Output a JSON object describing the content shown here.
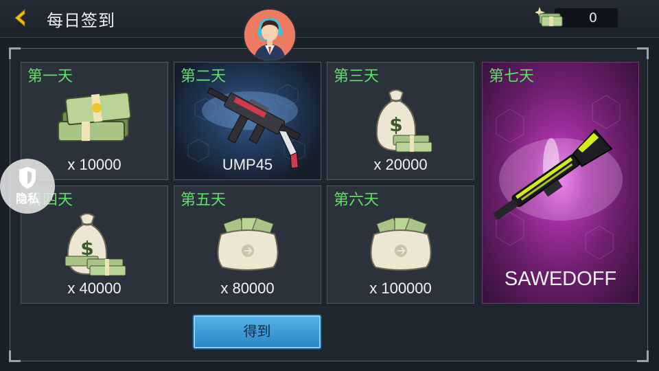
{
  "header": {
    "title": "每日签到",
    "currency_value": "0",
    "currency_icon": "cash-stack-icon",
    "back_icon": "chevron-left-icon"
  },
  "colors": {
    "day_label": "#5fe067",
    "accent_gold": "#f2c012",
    "button_blue": "#3a9ad8",
    "sawedoff_bg": "#a32fa3"
  },
  "privacy": {
    "label": "隐私",
    "icon": "shield-icon"
  },
  "rewards": [
    {
      "day": "第一天",
      "amount": "x 10000",
      "icon": "cash-stack-icon"
    },
    {
      "day": "第二天",
      "amount": "UMP45",
      "icon": "smg-icon"
    },
    {
      "day": "第三天",
      "amount": "x 20000",
      "icon": "money-bag-icon"
    },
    {
      "day": "第四天",
      "amount": "x 40000",
      "icon": "money-bag-icon"
    },
    {
      "day": "第五天",
      "amount": "x 80000",
      "icon": "cash-sack-icon"
    },
    {
      "day": "第六天",
      "amount": "x 100000",
      "icon": "cash-sack-icon"
    },
    {
      "day": "第七天",
      "amount": "SAWEDOFF",
      "icon": "shotgun-icon"
    }
  ],
  "claim_button": {
    "label": "得到"
  }
}
